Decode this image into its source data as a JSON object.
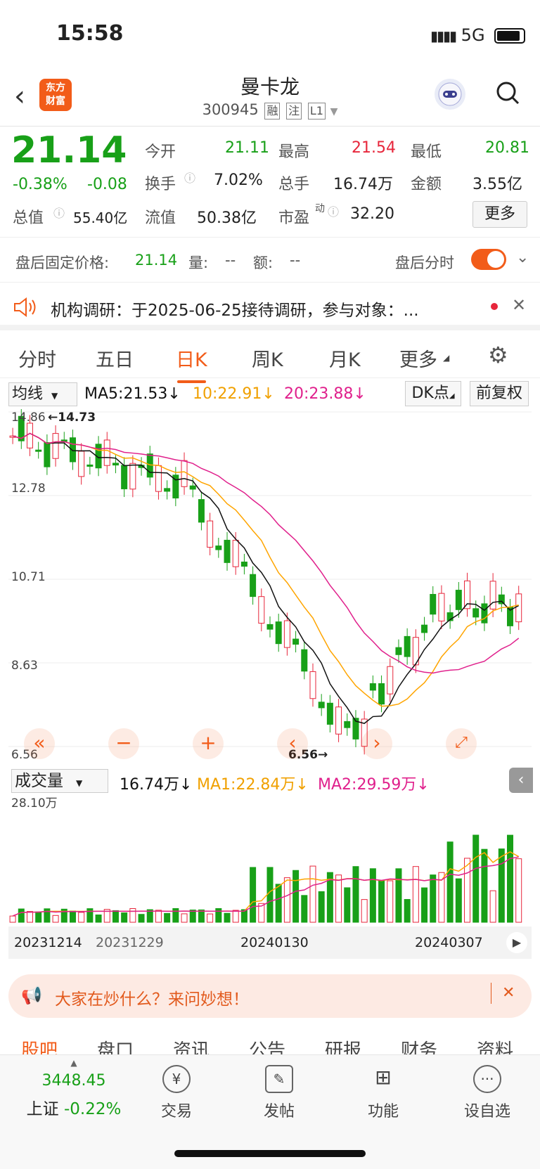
{
  "status": {
    "time": "15:58",
    "network": "5G"
  },
  "header": {
    "logo": "东方财富",
    "logo_l1": "东方",
    "logo_l2": "财富",
    "title": "曼卡龙",
    "code": "300945",
    "tags": [
      "融",
      "注",
      "L1"
    ]
  },
  "quote": {
    "price": "21.14",
    "change_pct": "-0.38%",
    "change": "-0.08",
    "open_label": "今开",
    "open": "21.11",
    "high_label": "最高",
    "high": "21.54",
    "low_label": "最低",
    "low": "20.81",
    "turnover_label": "换手",
    "turnover": "7.02%",
    "volume_label": "总手",
    "volume": "16.74万",
    "amount_label": "金额",
    "amount": "3.55亿",
    "mktcap_label": "总值",
    "mktcap": "55.40亿",
    "float_label": "流值",
    "float": "50.38亿",
    "pe_label": "市盈",
    "pe_sup": "动",
    "pe": "32.20",
    "more": "更多"
  },
  "after_hours": {
    "label": "盘后固定价格:",
    "price": "21.14",
    "vol_label": "量:",
    "vol": "--",
    "amt_label": "额:",
    "amt": "--",
    "intraday": "盘后分时"
  },
  "notice": {
    "text": "机构调研：于2025-06-25接待调研，参与对象：..."
  },
  "tabs": [
    "分时",
    "五日",
    "日K",
    "周K",
    "月K",
    "更多"
  ],
  "active_tab": "日K",
  "ma_bar": {
    "select": "均线",
    "ma5": "MA5:21.53↓",
    "ma10": "10:22.91↓",
    "ma20": "20:23.88↓",
    "dk": "DK点",
    "adjust": "前复权"
  },
  "colors": {
    "up": "#e7263b",
    "down": "#18a018",
    "accent": "#f25c19",
    "ma5": "#111111",
    "ma10": "#ffa500",
    "ma20": "#e0208c"
  },
  "chart_data": {
    "type": "candlestick",
    "price_axis": [
      "14.86",
      "12.78",
      "10.71",
      "8.63",
      "6.56"
    ],
    "ylim": [
      6.56,
      14.86
    ],
    "high_label": "14.73",
    "low_label": "6.56",
    "x_labels": [
      "20231214",
      "20231229",
      "20240130",
      "20240307"
    ],
    "volume_axis_top": "28.10万",
    "volume_select": "成交量",
    "volume_value": "16.74万↓",
    "vol_ma1": "MA1:22.84万↓",
    "vol_ma2": "MA2:29.59万↓"
  },
  "ad": {
    "text": "大家在炒什么？来问妙想！"
  },
  "bottom_tabs": [
    "股吧",
    "盘口",
    "资讯",
    "公告",
    "研报",
    "财务",
    "资料"
  ],
  "nav": {
    "index_value": "3448.45",
    "index_name": "上证",
    "index_change": "-0.22%",
    "items": [
      "交易",
      "发帖",
      "功能",
      "设自选"
    ]
  }
}
